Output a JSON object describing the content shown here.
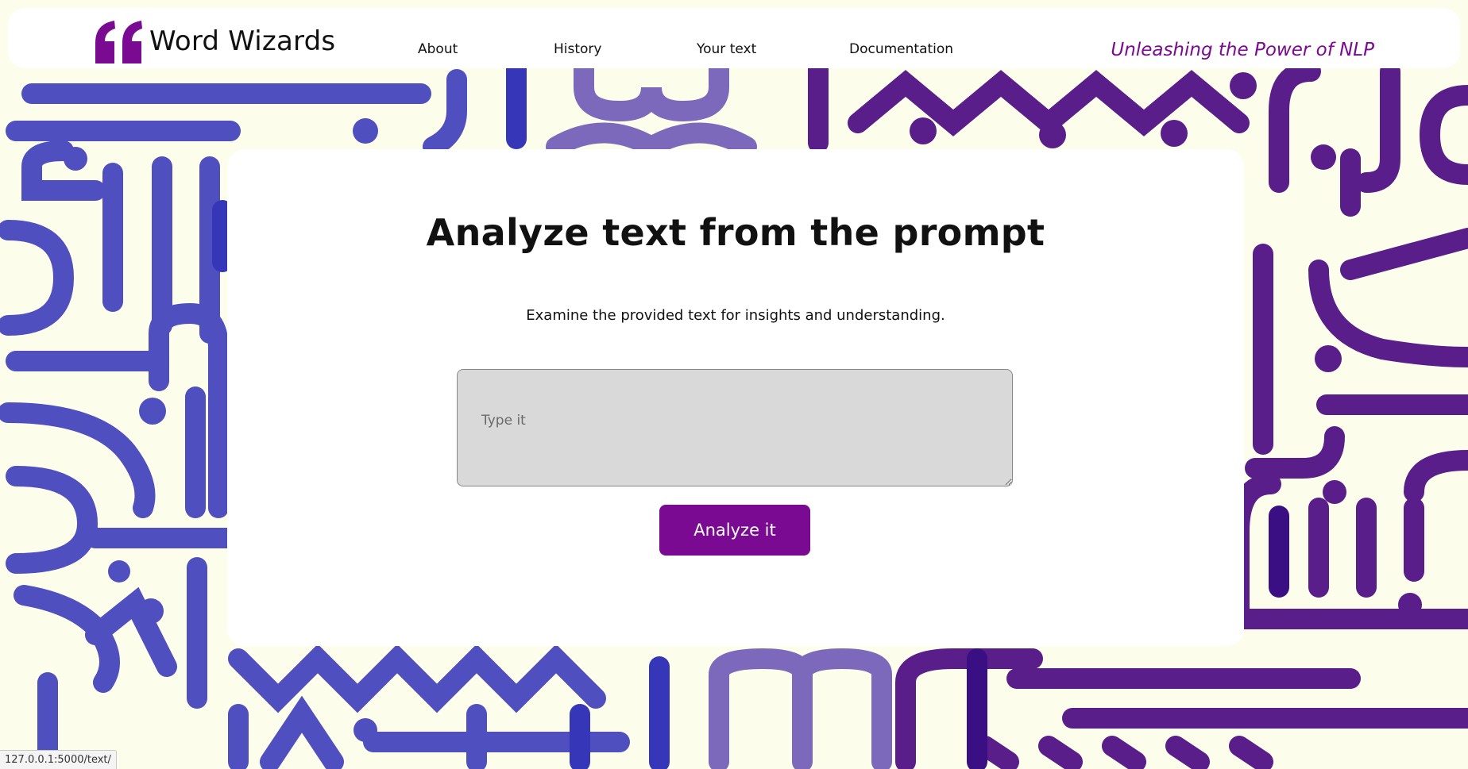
{
  "brand": {
    "name": "Word Wizards",
    "logo_icon": "quote-mark-icon"
  },
  "nav": {
    "about": "About",
    "history": "History",
    "your_text": "Your text",
    "documentation": "Documentation"
  },
  "tagline": "Unleashing the Power of NLP",
  "main": {
    "title": "Analyze text from the prompt",
    "subtitle": "Examine the provided text for insights and understanding.",
    "input_placeholder": "Type it",
    "input_value": "",
    "button_label": "Analyze it"
  },
  "status_bar": {
    "url": "127.0.0.1:5000/text/"
  },
  "colors": {
    "accent": "#7b0a92",
    "background": "#fdfdec",
    "pattern_blue": "#4f4fbf",
    "pattern_lavender": "#7d69bb",
    "pattern_purple": "#5a1e8a",
    "input_bg": "#d9d9d9"
  }
}
